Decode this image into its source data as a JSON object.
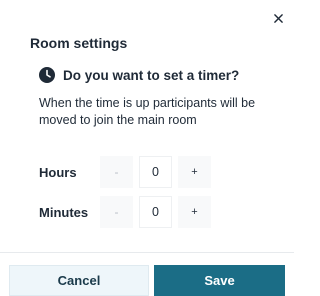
{
  "dialog": {
    "title": "Room settings",
    "close_icon": "close-icon",
    "question_icon": "clock-icon",
    "question": "Do you want to set a timer?",
    "description": "When the time is up participants will be moved to join the main room"
  },
  "timer": {
    "hours": {
      "label": "Hours",
      "decrement_label": "-",
      "value": "0",
      "increment_label": "+"
    },
    "minutes": {
      "label": "Minutes",
      "decrement_label": "-",
      "value": "0",
      "increment_label": "+"
    }
  },
  "footer": {
    "cancel_label": "Cancel",
    "save_label": "Save"
  },
  "colors": {
    "primary": "#1b6d86",
    "secondary_bg": "#eef6fa",
    "text": "#1f2a37"
  }
}
